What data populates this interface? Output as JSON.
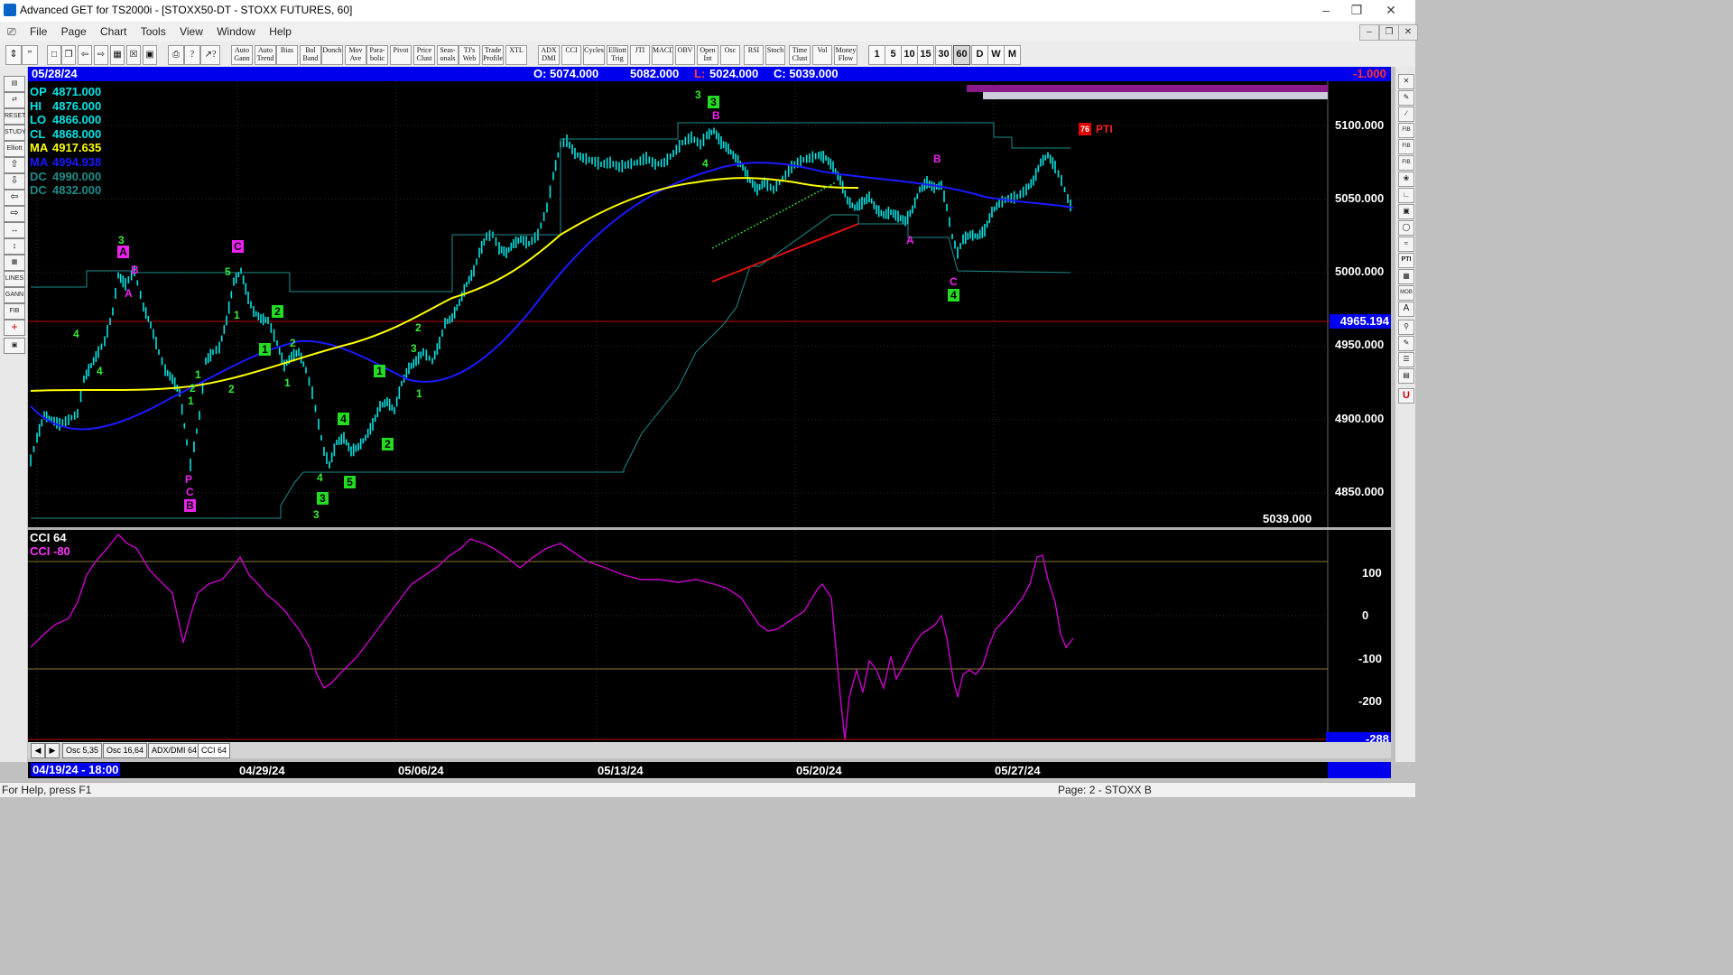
{
  "window": {
    "title": "Advanced GET for TS2000i - [STOXX50-DT - STOXX FUTURES, 60]"
  },
  "menu": [
    "File",
    "Page",
    "Chart",
    "Tools",
    "View",
    "Window",
    "Help"
  ],
  "toolbar": {
    "tools": [
      "Auto Gann",
      "Auto Trend",
      "Bias",
      "Bol Band",
      "Donch",
      "Mov Ave",
      "Para-bolic",
      "Pivot",
      "Price Clust",
      "Seas-onals",
      "TJ's Web",
      "Trade Profile",
      "XTL",
      "ADX DMI",
      "CCI",
      "Cycles",
      "Elliott Trig",
      "JTI",
      "MACD",
      "OBV",
      "Open Int",
      "Osc",
      "RSI",
      "Stoch",
      "Time Clust",
      "Vol",
      "Money Flow"
    ],
    "intervals": [
      "1",
      "5",
      "10",
      "15",
      "30",
      "60",
      "D",
      "W",
      "M"
    ],
    "selected_interval": "60"
  },
  "header": {
    "date": "05/28/24",
    "open": "O: 5074.000",
    "high": "5082.000",
    "low_label": "L:",
    "low": "5024.000",
    "close": "C: 5039.000",
    "change": "-1.000"
  },
  "legend": [
    {
      "label": "OP",
      "value": "4871.000",
      "color": "#00e5e5"
    },
    {
      "label": "HI",
      "value": "4876.000",
      "color": "#00e5e5"
    },
    {
      "label": "LO",
      "value": "4866.000",
      "color": "#00e5e5"
    },
    {
      "label": "CL",
      "value": "4868.000",
      "color": "#00e5e5"
    },
    {
      "label": "MA",
      "value": "4917.635",
      "color": "#ffff00"
    },
    {
      "label": "MA",
      "value": "4994.938",
      "color": "#1a1aff"
    },
    {
      "label": "DC",
      "value": "4990.000",
      "color": "#1e8c8c"
    },
    {
      "label": "DC",
      "value": "4832.000",
      "color": "#1e8c8c"
    }
  ],
  "price_axis": [
    "5100.000",
    "5050.000",
    "5000.000",
    "4950.000",
    "4900.000",
    "4850.000"
  ],
  "price_marker": "4965.194",
  "last_price": "5039.000",
  "pti": {
    "value": "76",
    "label": "PTI"
  },
  "elliott_labels": {
    "green_plain": [
      "3",
      "3",
      "5",
      "4",
      "4",
      "1",
      "2",
      "1",
      "2",
      "1",
      "3",
      "3",
      "4",
      "4",
      "1",
      "2",
      "1",
      "2"
    ],
    "green_boxed": [
      "3",
      "2",
      "1",
      "1",
      "4",
      "2",
      "3",
      "5",
      "4"
    ],
    "magenta_boxed": [
      "A",
      "C",
      "B"
    ],
    "magenta_plain": [
      "B",
      "A",
      "P",
      "C",
      "B",
      "A",
      "B",
      "C"
    ]
  },
  "indicator": {
    "title": "CCI 64",
    "legend": "CCI  -80",
    "axis": [
      "100",
      "0",
      "-100",
      "-200"
    ],
    "marker": "-288"
  },
  "tabs": [
    "Osc 5,35",
    "Osc 16,64",
    "ADX/DMI 64",
    "CCI 64"
  ],
  "dates": [
    "04/19/24 - 18:00",
    "04/29/24",
    "05/06/24",
    "05/13/24",
    "05/20/24",
    "05/27/24"
  ],
  "status": {
    "left": "For Help, press F1",
    "right": "Page: 2 - STOXX B"
  },
  "colors": {
    "bars": "#00e5e5",
    "ma_fast": "#ffff00",
    "ma_slow": "#1a1aff",
    "donchian": "#1e8c8c",
    "cci": "#cc00cc",
    "header": "#0000ee"
  }
}
